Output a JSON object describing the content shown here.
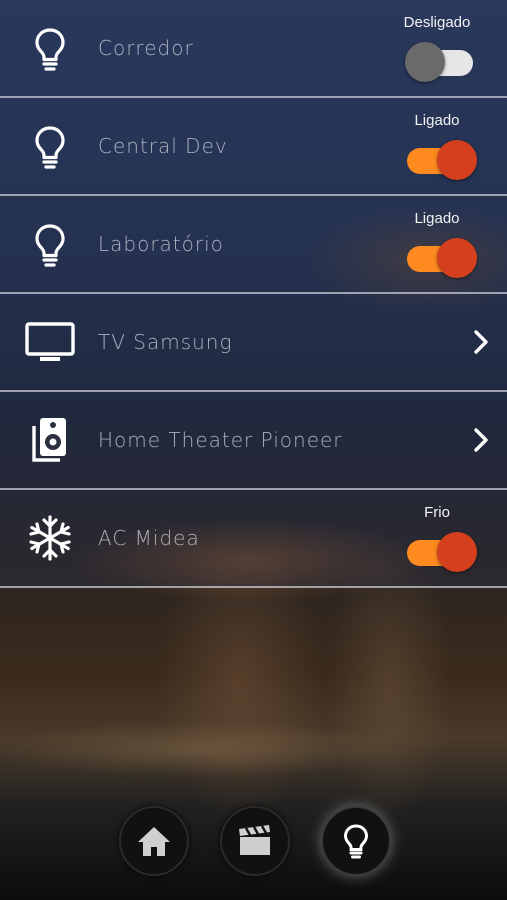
{
  "devices": [
    {
      "name": "Corredor",
      "icon": "lightbulb-icon",
      "status": "Desligado",
      "control": "toggle",
      "on": false
    },
    {
      "name": "Central Dev",
      "icon": "lightbulb-icon",
      "status": "Ligado",
      "control": "toggle",
      "on": true
    },
    {
      "name": "Laboratório",
      "icon": "lightbulb-icon",
      "status": "Ligado",
      "control": "toggle",
      "on": true
    },
    {
      "name": "TV Samsung",
      "icon": "tv-icon",
      "control": "chevron"
    },
    {
      "name": "Home Theater Pioneer",
      "icon": "speaker-icon",
      "control": "chevron"
    },
    {
      "name": "AC Midea",
      "icon": "snowflake-icon",
      "status": "Frio",
      "control": "toggle",
      "on": true
    }
  ],
  "bottom_nav": [
    {
      "name": "home",
      "icon": "home-icon",
      "active": false
    },
    {
      "name": "scenes",
      "icon": "clapperboard-icon",
      "active": false
    },
    {
      "name": "lights",
      "icon": "lightbulb-icon",
      "active": true
    }
  ],
  "colors": {
    "toggle_on_track": "#ff8a1f",
    "toggle_on_knob": "#d4401e",
    "toggle_off_track": "#e6e6e6",
    "toggle_off_knob": "#6a6a6a"
  }
}
